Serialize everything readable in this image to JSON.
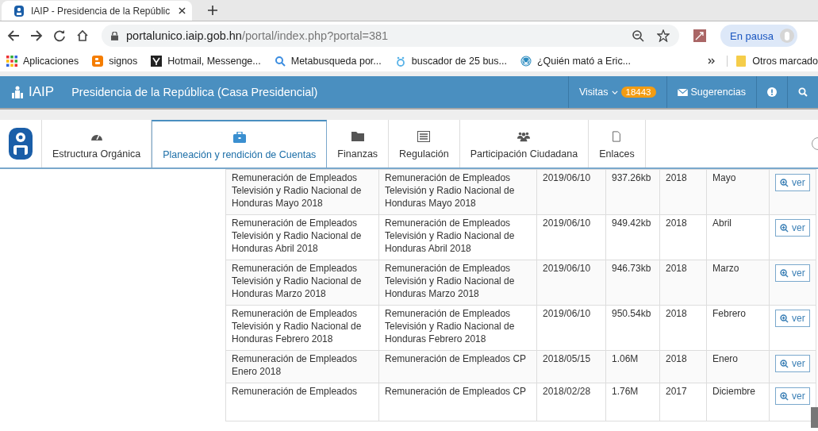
{
  "browser": {
    "tab_title": "IAIP - Presidencia de la Repúblic",
    "url_host": "portalunico.iaip.gob.hn",
    "url_path": "/portal/index.php?portal=381",
    "profile_label": "En pausa",
    "bookmarks": [
      {
        "label": "Aplicaciones"
      },
      {
        "label": "signos"
      },
      {
        "label": "Hotmail, Messenge..."
      },
      {
        "label": "Metabusqueda por..."
      },
      {
        "label": "buscador de 25 bus..."
      },
      {
        "label": "¿Quién mató a Eric..."
      }
    ],
    "other_bookmarks": "Otros marcado"
  },
  "site_header": {
    "logo": "IAIP",
    "title": "Presidencia de la República (Casa Presidencial)",
    "visits_label": "Visitas",
    "visits_count": "18443",
    "suggestions": "Sugerencias"
  },
  "nav_tabs": [
    {
      "label": "Estructura Orgánica",
      "selected": false
    },
    {
      "label": "Planeación y rendición de Cuentas",
      "selected": true
    },
    {
      "label": "Finanzas",
      "selected": false
    },
    {
      "label": "Regulación",
      "selected": false
    },
    {
      "label": "Participación Ciudadana",
      "selected": false
    },
    {
      "label": "Enlaces",
      "selected": false
    }
  ],
  "table": {
    "rows": [
      {
        "name": "Remuneración de Empleados Televisión y Radio Nacional de Honduras Mayo 2018",
        "description": "Remuneración de Empleados Televisión y Radio Nacional de Honduras Mayo 2018",
        "date": "2019/06/10",
        "size": "937.26kb",
        "year": "2018",
        "month": "Mayo",
        "action": "ver"
      },
      {
        "name": "Remuneración de Empleados Televisión y Radio Nacional de Honduras Abril 2018",
        "description": "Remuneración de Empleados Televisión y Radio Nacional de Honduras Abril 2018",
        "date": "2019/06/10",
        "size": "949.42kb",
        "year": "2018",
        "month": "Abril",
        "action": "ver"
      },
      {
        "name": "Remuneración de Empleados Televisión y Radio Nacional de Honduras Marzo 2018",
        "description": "Remuneración de Empleados Televisión y Radio Nacional de Honduras Marzo 2018",
        "date": "2019/06/10",
        "size": "946.73kb",
        "year": "2018",
        "month": "Marzo",
        "action": "ver"
      },
      {
        "name": "Remuneración de Empleados Televisión y Radio Nacional de Honduras Febrero 2018",
        "description": "Remuneración de Empleados Televisión y Radio Nacional de Honduras Febrero 2018",
        "date": "2019/06/10",
        "size": "950.54kb",
        "year": "2018",
        "month": "Febrero",
        "action": "ver"
      },
      {
        "name": "Remuneración de Empleados Enero 2018",
        "description": "Remuneración de Empleados CP",
        "date": "2018/05/15",
        "size": "1.06M",
        "year": "2018",
        "month": "Enero",
        "action": "ver"
      },
      {
        "name": "Remuneración de Empleados",
        "description": "Remuneración de Empleados CP",
        "date": "2018/02/28",
        "size": "1.76M",
        "year": "2017",
        "month": "Diciembre",
        "action": "ver"
      }
    ]
  }
}
